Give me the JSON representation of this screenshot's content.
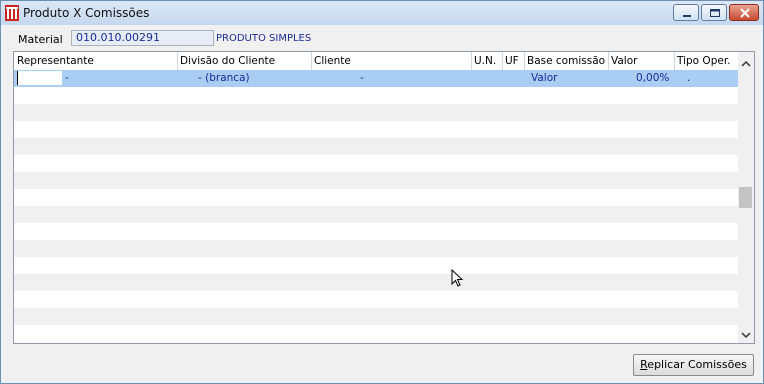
{
  "window": {
    "title": "Produto X Comissões"
  },
  "material": {
    "label": "Material",
    "code": "010.010.00291",
    "description": "PRODUTO SIMPLES"
  },
  "grid": {
    "columns": [
      "Representante",
      "Divisão do Cliente",
      "Cliente",
      "U.N.",
      "UF",
      "Base comissão",
      "Valor",
      "Tipo Oper."
    ],
    "rows": [
      {
        "representante": "-",
        "divisao": "- (branca)",
        "cliente": "-",
        "un": "",
        "uf": "",
        "base": "Valor",
        "valor": "0,00%",
        "tipo": "."
      }
    ]
  },
  "footer": {
    "replicar_first": "R",
    "replicar_rest": "eplicar Comissões"
  }
}
